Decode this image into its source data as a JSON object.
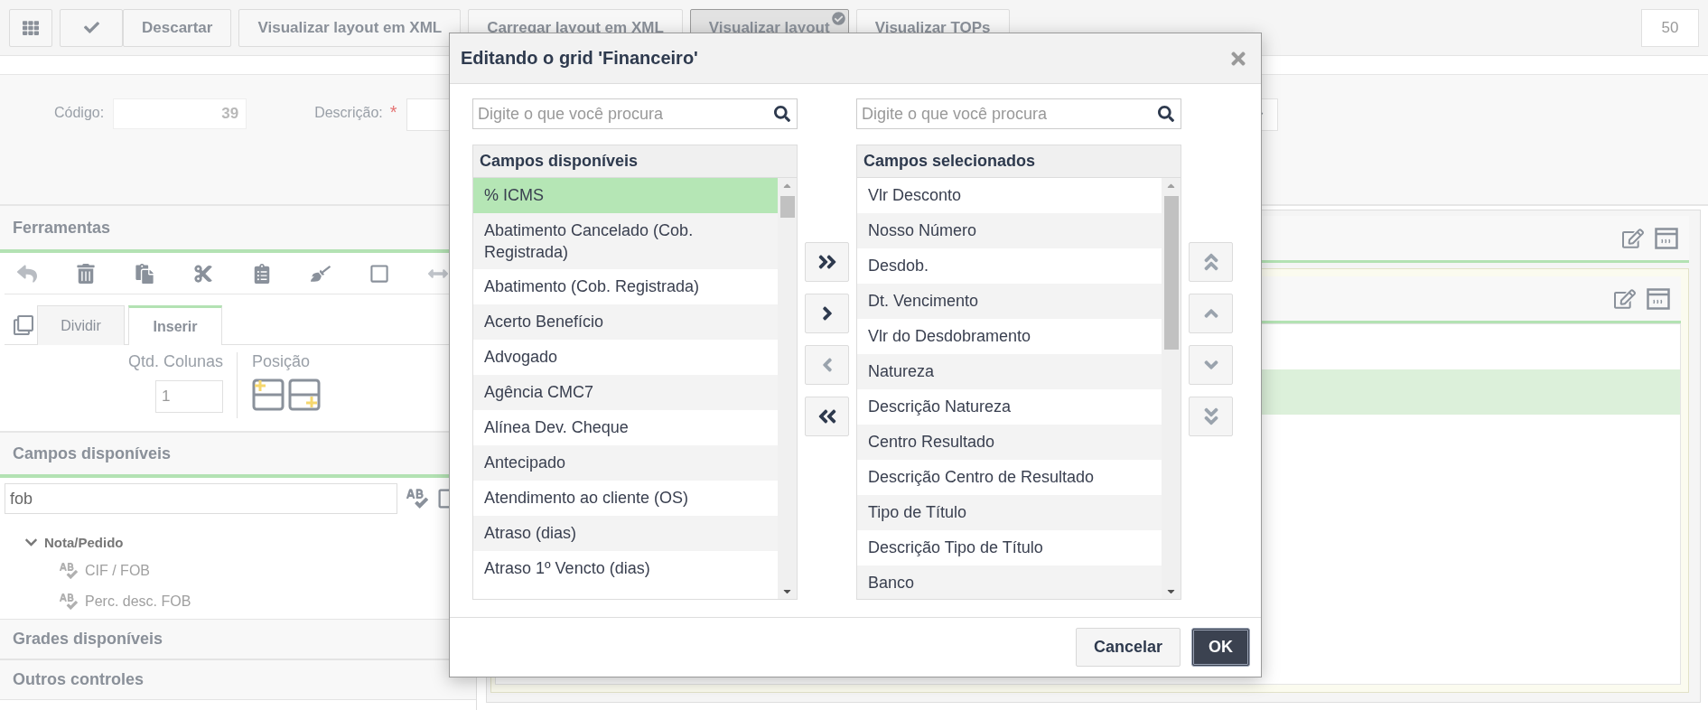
{
  "toolbar": {
    "buttons": [
      {
        "label": "Descartar",
        "selected": false
      },
      {
        "label": "Visualizar layout em XML",
        "selected": false
      },
      {
        "label": "Carregar layout em XML",
        "selected": false
      },
      {
        "label": "Visualizar layout",
        "selected": true
      },
      {
        "label": "Visualizar TOPs",
        "selected": false
      }
    ],
    "counter": "50"
  },
  "form": {
    "code_label": "Código:",
    "code_value": "39",
    "description_label": "Descrição:",
    "required_mark": "*"
  },
  "tools_panel": {
    "title": "Ferramentas",
    "tabs": [
      {
        "label": "Dividir",
        "selected": false
      },
      {
        "label": "Inserir",
        "selected": true
      }
    ],
    "columns_label": "Qtd. Colunas",
    "columns_value": "1",
    "position_label": "Posição"
  },
  "fields_panel": {
    "title": "Campos disponíveis",
    "search_value": "fob",
    "tree": [
      {
        "label": "Nota/Pedido",
        "expanded": true,
        "children": [
          {
            "label": "CIF / FOB"
          },
          {
            "label": "Perc. desc. FOB"
          }
        ]
      }
    ]
  },
  "other_panels": [
    "Grades disponíveis",
    "Outros controles"
  ],
  "dialog": {
    "title": "Editando o grid 'Financeiro'",
    "available": {
      "placeholder": "Digite o que você procura",
      "heading": "Campos disponíveis",
      "items": [
        {
          "label": "% ICMS",
          "selected": true
        },
        {
          "label": "Abatimento Cancelado (Cob. Registrada)",
          "selected": false
        },
        {
          "label": "Abatimento (Cob. Registrada)",
          "selected": false
        },
        {
          "label": "Acerto Benefício",
          "selected": false
        },
        {
          "label": "Advogado",
          "selected": false
        },
        {
          "label": "Agência CMC7",
          "selected": false
        },
        {
          "label": "Alínea Dev. Cheque",
          "selected": false
        },
        {
          "label": "Antecipado",
          "selected": false
        },
        {
          "label": "Atendimento ao cliente (OS)",
          "selected": false
        },
        {
          "label": "Atraso (dias)",
          "selected": false
        },
        {
          "label": "Atraso 1º Vencto (dias)",
          "selected": false
        }
      ]
    },
    "transfer_buttons": [
      {
        "kind": "add_all",
        "disabled": false
      },
      {
        "kind": "add",
        "disabled": false
      },
      {
        "kind": "remove",
        "disabled": true
      },
      {
        "kind": "remove_all",
        "disabled": false
      }
    ],
    "chosen": {
      "placeholder": "Digite o que você procura",
      "heading": "Campos selecionados",
      "items": [
        {
          "label": "Vlr Desconto",
          "selected": false
        },
        {
          "label": "Nosso Número",
          "selected": false
        },
        {
          "label": "Desdob.",
          "selected": false
        },
        {
          "label": "Dt. Vencimento",
          "selected": false
        },
        {
          "label": "Vlr do Desdobramento",
          "selected": false
        },
        {
          "label": "Natureza",
          "selected": false
        },
        {
          "label": "Descrição Natureza",
          "selected": false
        },
        {
          "label": "Centro Resultado",
          "selected": false
        },
        {
          "label": "Descrição Centro de Resultado",
          "selected": false
        },
        {
          "label": "Tipo de Título",
          "selected": false
        },
        {
          "label": "Descrição Tipo de Título",
          "selected": false
        },
        {
          "label": "Banco",
          "selected": false
        }
      ]
    },
    "order_buttons": [
      {
        "kind": "top",
        "disabled": true
      },
      {
        "kind": "up",
        "disabled": true
      },
      {
        "kind": "down",
        "disabled": true
      },
      {
        "kind": "bottom",
        "disabled": true
      }
    ],
    "cancel_label": "Cancelar",
    "ok_label": "OK"
  }
}
